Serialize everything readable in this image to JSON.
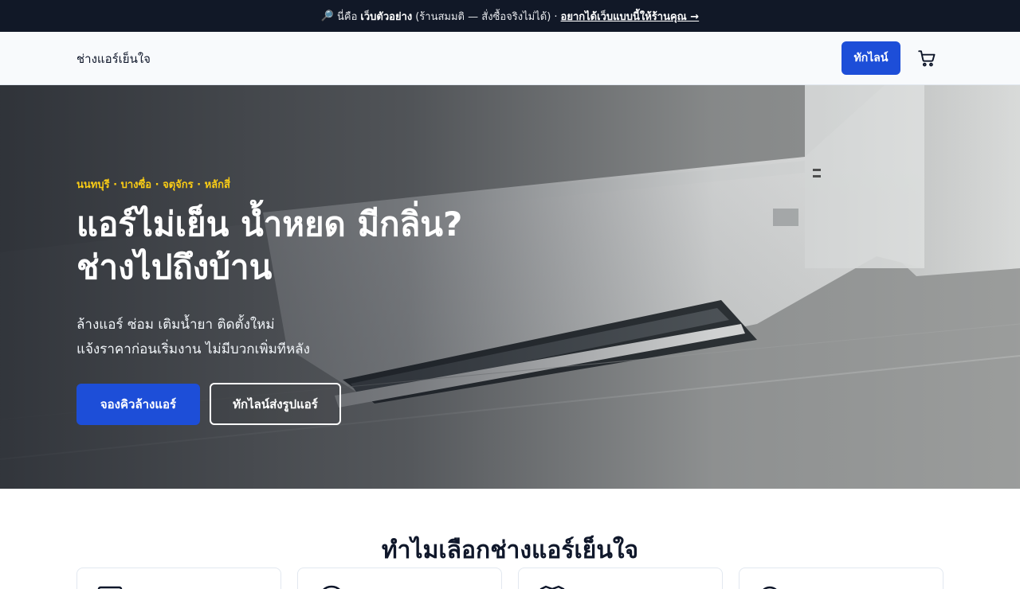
{
  "banner": {
    "icon": "magnifier-icon",
    "prefix": "นี่คือ",
    "bold": "เว็บตัวอย่าง",
    "middle": "(ร้านสมมติ — สั่งซื้อจริงไม่ได้) ·",
    "link": "อยากได้เว็บแบบนี้ให้ร้านคุณ →"
  },
  "header": {
    "brand": "ช่างแอร์เย็นใจ",
    "line_button": "ทักไลน์",
    "cart_icon": "cart-icon"
  },
  "hero": {
    "kicker": "นนทบุรี · บางซื่อ · จตุจักร · หลักสี่",
    "headline_line1": "แอร์ไม่เย็น น้ำหยด มีกลิ่น?",
    "headline_line2": "ช่างไปถึงบ้าน",
    "sub_line1": "ล้างแอร์ ซ่อม เติมน้ำยา ติดตั้งใหม่",
    "sub_line2": "แจ้งราคาก่อนเริ่มงาน ไม่มีบวกเพิ่มทีหลัง",
    "primary_button": "จองคิวล้างแอร์",
    "secondary_button": "ทักไลน์ส่งรูปแอร์",
    "image": "air-conditioner-photo"
  },
  "why": {
    "title": "ทำไมเลือกช่างแอร์เย็นใจ",
    "cards": [
      {
        "icon": "price-tag-icon"
      },
      {
        "icon": "clock-icon"
      },
      {
        "icon": "shield-icon"
      },
      {
        "icon": "badge-icon"
      }
    ]
  },
  "colors": {
    "banner_bg": "#111827",
    "accent": "#1d4ed8",
    "kicker": "#facc15"
  }
}
